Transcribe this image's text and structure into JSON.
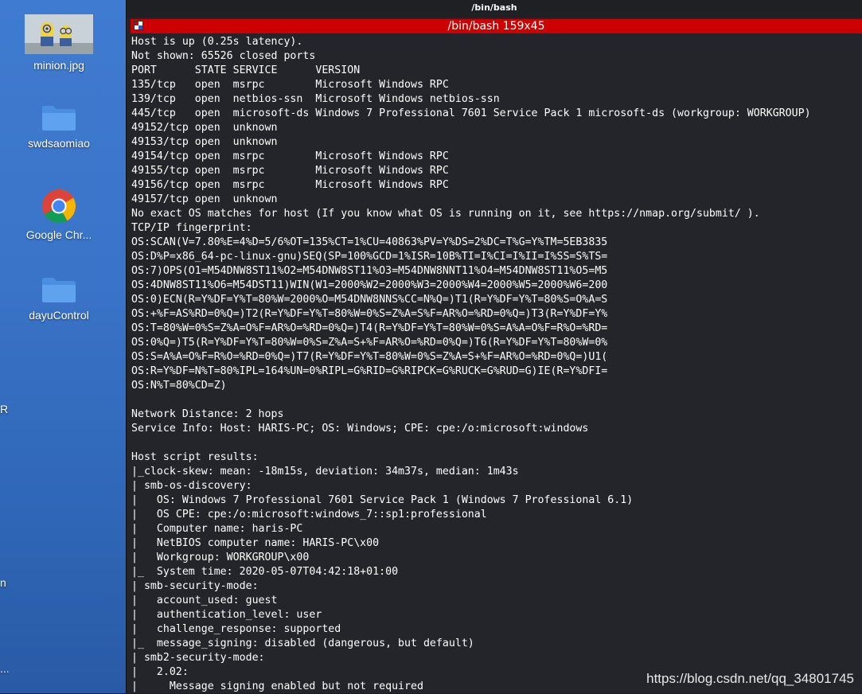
{
  "desktop": {
    "icons": [
      {
        "label": "minion.jpg",
        "icon": "image-thumbnail-icon"
      },
      {
        "label": "swdsaomiao",
        "icon": "folder-icon"
      },
      {
        "label": "Google Chr...",
        "icon": "chrome-icon"
      },
      {
        "label": "dayuControl",
        "icon": "folder-icon"
      }
    ],
    "edge_labels": [
      "R",
      "n",
      "..."
    ]
  },
  "terminal": {
    "window_title": "/bin/bash",
    "tab_title": "/bin/bash 159x45",
    "lines": [
      "Host is up (0.25s latency).",
      "Not shown: 65526 closed ports",
      "PORT      STATE SERVICE      VERSION",
      "135/tcp   open  msrpc        Microsoft Windows RPC",
      "139/tcp   open  netbios-ssn  Microsoft Windows netbios-ssn",
      "445/tcp   open  microsoft-ds Windows 7 Professional 7601 Service Pack 1 microsoft-ds (workgroup: WORKGROUP)",
      "49152/tcp open  unknown",
      "49153/tcp open  unknown",
      "49154/tcp open  msrpc        Microsoft Windows RPC",
      "49155/tcp open  msrpc        Microsoft Windows RPC",
      "49156/tcp open  msrpc        Microsoft Windows RPC",
      "49157/tcp open  unknown",
      "No exact OS matches for host (If you know what OS is running on it, see https://nmap.org/submit/ ).",
      "TCP/IP fingerprint:",
      "OS:SCAN(V=7.80%E=4%D=5/6%OT=135%CT=1%CU=40863%PV=Y%DS=2%DC=T%G=Y%TM=5EB3835",
      "OS:D%P=x86_64-pc-linux-gnu)SEQ(SP=100%GCD=1%ISR=10B%TI=I%CI=I%II=I%SS=S%TS=",
      "OS:7)OPS(O1=M54DNW8ST11%O2=M54DNW8ST11%O3=M54DNW8NNT11%O4=M54DNW8ST11%O5=M5",
      "OS:4DNW8ST11%O6=M54DST11)WIN(W1=2000%W2=2000%W3=2000%W4=2000%W5=2000%W6=200",
      "OS:0)ECN(R=Y%DF=Y%T=80%W=2000%O=M54DNW8NNS%CC=N%Q=)T1(R=Y%DF=Y%T=80%S=O%A=S",
      "OS:+%F=AS%RD=0%Q=)T2(R=Y%DF=Y%T=80%W=0%S=Z%A=S%F=AR%O=%RD=0%Q=)T3(R=Y%DF=Y%",
      "OS:T=80%W=0%S=Z%A=O%F=AR%O=%RD=0%Q=)T4(R=Y%DF=Y%T=80%W=0%S=A%A=O%F=R%O=%RD=",
      "OS:0%Q=)T5(R=Y%DF=Y%T=80%W=0%S=Z%A=S+%F=AR%O=%RD=0%Q=)T6(R=Y%DF=Y%T=80%W=0%",
      "OS:S=A%A=O%F=R%O=%RD=0%Q=)T7(R=Y%DF=Y%T=80%W=0%S=Z%A=S+%F=AR%O=%RD=0%Q=)U1(",
      "OS:R=Y%DF=N%T=80%IPL=164%UN=0%RIPL=G%RID=G%RIPCK=G%RUCK=G%RUD=G)IE(R=Y%DFI=",
      "OS:N%T=80%CD=Z)",
      "",
      "Network Distance: 2 hops",
      "Service Info: Host: HARIS-PC; OS: Windows; CPE: cpe:/o:microsoft:windows",
      "",
      "Host script results:",
      "|_clock-skew: mean: -18m15s, deviation: 34m37s, median: 1m43s",
      "| smb-os-discovery:",
      "|   OS: Windows 7 Professional 7601 Service Pack 1 (Windows 7 Professional 6.1)",
      "|   OS CPE: cpe:/o:microsoft:windows_7::sp1:professional",
      "|   Computer name: haris-PC",
      "|   NetBIOS computer name: HARIS-PC\\x00",
      "|   Workgroup: WORKGROUP\\x00",
      "|_  System time: 2020-05-07T04:42:18+01:00",
      "| smb-security-mode:",
      "|   account_used: guest",
      "|   authentication_level: user",
      "|   challenge_response: supported",
      "|_  message_signing: disabled (dangerous, but default)",
      "| smb2-security-mode:",
      "|   2.02:",
      "|     Message signing enabled but not required"
    ]
  },
  "watermark": "https://blog.csdn.net/qq_34801745",
  "colors": {
    "tab_red": "#cc0000",
    "terminal_bg": "#23252b",
    "desktop_blue": "#3a74c8"
  }
}
